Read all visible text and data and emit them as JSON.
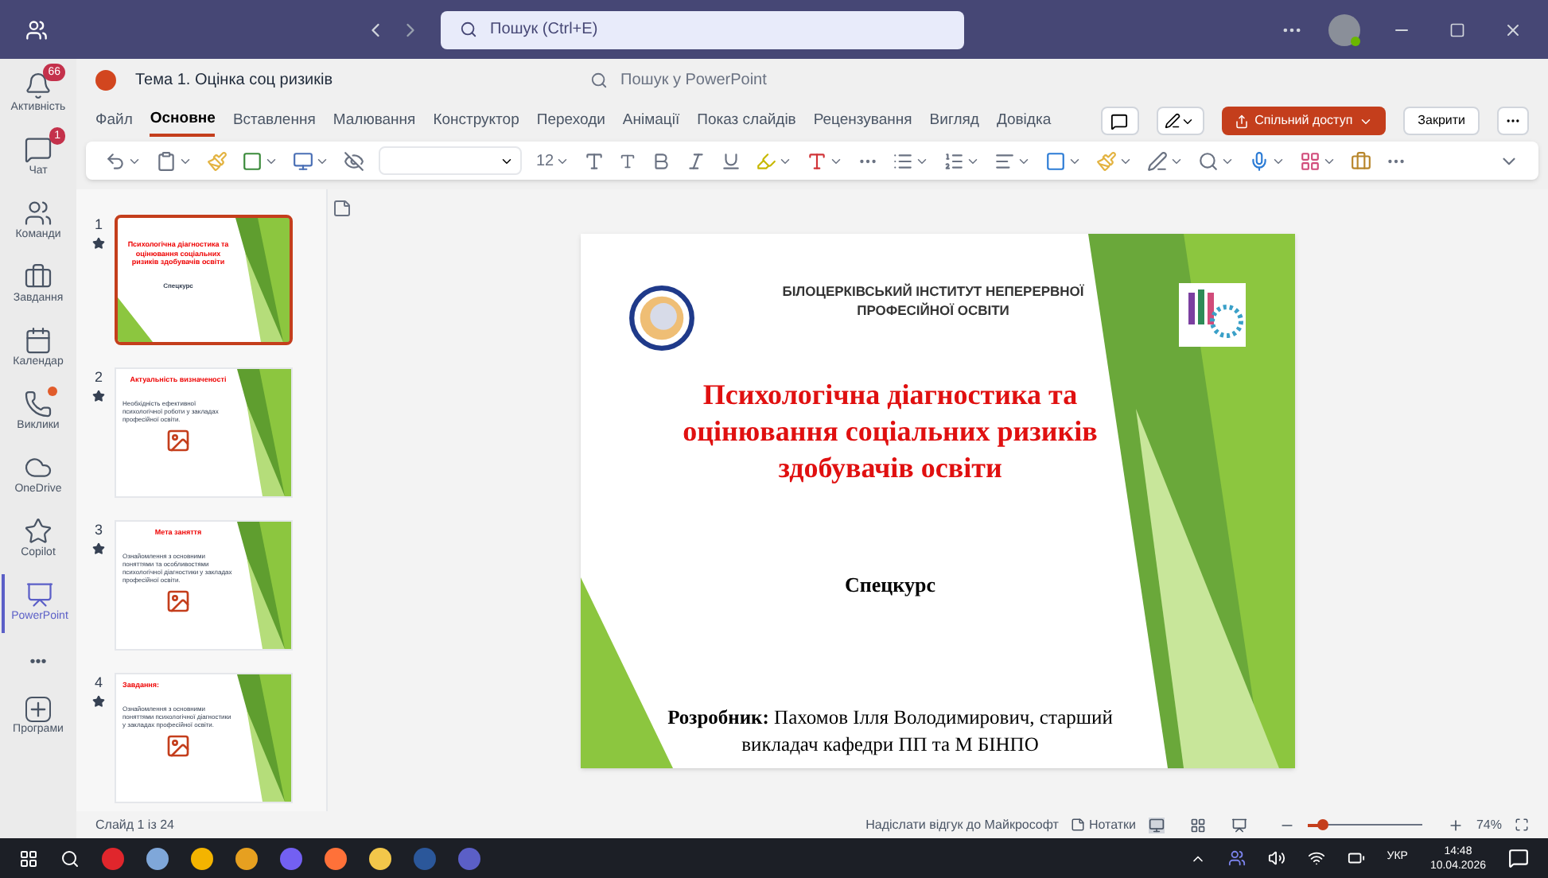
{
  "titlebar": {
    "search_placeholder": "Пошук (Ctrl+E)"
  },
  "rail": [
    {
      "kind": "app",
      "label": "Активність",
      "badge": "66",
      "dot": false,
      "selected": false
    },
    {
      "kind": "app",
      "label": "Чат",
      "badge": "1",
      "dot": false,
      "selected": false
    },
    {
      "kind": "app",
      "label": "Команди",
      "dot": false,
      "selected": false
    },
    {
      "kind": "app",
      "label": "Завдання",
      "dot": false,
      "selected": false
    },
    {
      "kind": "app",
      "label": "Календар",
      "dot": false,
      "selected": false
    },
    {
      "kind": "app",
      "label": "Виклики",
      "dot": true,
      "selected": false
    },
    {
      "kind": "app",
      "label": "OneDrive",
      "dot": false,
      "selected": false
    },
    {
      "kind": "app",
      "label": "Copilot",
      "dot": false,
      "selected": false
    },
    {
      "kind": "app",
      "label": "PowerPoint",
      "dot": false,
      "selected": true
    },
    {
      "kind": "more",
      "label": "•••"
    },
    {
      "kind": "add",
      "label": "Програми"
    }
  ],
  "document": {
    "title": "Тема 1. Оцінка соц ризиків",
    "search_placeholder": "Пошук у PowerPoint"
  },
  "tabs": [
    {
      "label": "Файл",
      "selected": false
    },
    {
      "label": "Основне",
      "selected": true
    },
    {
      "label": "Вставлення",
      "selected": false
    },
    {
      "label": "Малювання",
      "selected": false
    },
    {
      "label": "Конструктор",
      "selected": false
    },
    {
      "label": "Переходи",
      "selected": false
    },
    {
      "label": "Анімації",
      "selected": false
    },
    {
      "label": "Показ слайдів",
      "selected": false
    },
    {
      "label": "Рецензування",
      "selected": false
    },
    {
      "label": "Вигляд",
      "selected": false
    },
    {
      "label": "Довідка",
      "selected": false
    }
  ],
  "share_button": "Спільний доступ",
  "close_button": "Закрити",
  "toolbar": {
    "font_size": "12"
  },
  "thumbnails": [
    {
      "number": "1",
      "kind": "title",
      "selected": true,
      "title": "Психологічна діагностика та оцінювання соціальних ризиків здобувачів освіти",
      "body": "Спецкурс"
    },
    {
      "number": "2",
      "kind": "content",
      "selected": false,
      "title": "Актуальність визначеності",
      "body": "Необхідність ефективної психологічної роботи у закладах професійної освіти."
    },
    {
      "number": "3",
      "kind": "content",
      "selected": false,
      "title": "Мета заняття",
      "body": "Ознайомлення з основними поняттями та особливостями психологічної діагностики у закладах професійної освіти."
    },
    {
      "number": "4",
      "kind": "list",
      "selected": false,
      "title": "Завдання:",
      "body": "Ознайомлення з основними поняттями психологічної діагностики у закладах професійної освіти."
    }
  ],
  "slide": {
    "institute": "БІЛОЦЕРКІВСЬКИЙ ІНСТИТУТ НЕПЕРЕРВНОЇ ПРОФЕСІЙНОЇ ОСВІТИ",
    "title": "Психологічна діагностика та оцінювання соціальних ризиків здобувачів освіти",
    "subtitle": "Спецкурс",
    "author": "**Розробник:** Пахомов Ілля Володимирович, старший викладач кафедри ПП та М БІНПО"
  },
  "status_bar": {
    "slide_counter": "Слайд 1 із 24",
    "feedback": "Надіслати відгук до Майкрософт",
    "notes": "Нотатки",
    "zoom": "74%",
    "zoom_slider": {
      "level": 0.12
    }
  },
  "taskbar": {
    "language": "УКР",
    "time": "14:48",
    "date": "10.04.2026"
  }
}
